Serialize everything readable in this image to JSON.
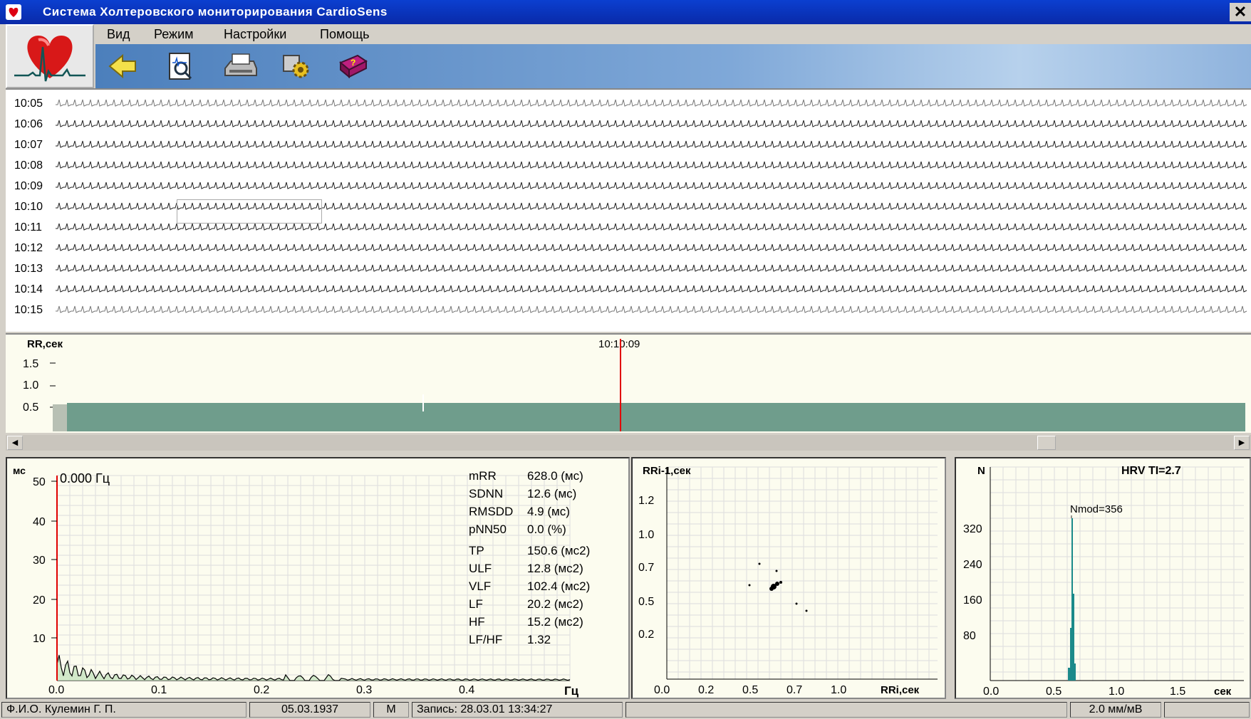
{
  "window": {
    "title": "Система   Холтеровского   мониторирования   CardioSens",
    "close": "✕"
  },
  "menu": {
    "items": [
      "Вид",
      "Режим",
      "Настройки",
      "Помощь"
    ]
  },
  "toolbar": {
    "buttons": [
      "back-arrow-icon",
      "magnifier-document-icon",
      "printer-icon",
      "settings-gear-icon",
      "help-book-icon"
    ]
  },
  "ecg": {
    "times": [
      "10:05",
      "10:06",
      "10:07",
      "10:08",
      "10:09",
      "10:10",
      "10:11",
      "10:12",
      "10:13",
      "10:14",
      "10:15"
    ]
  },
  "rr_trend": {
    "axis_label": "RR,сек",
    "cursor_time": "10:10:09",
    "ticks": [
      "1.5",
      "1.0",
      "0.5"
    ],
    "cursor_fraction": 0.47
  },
  "spectrum": {
    "unit_label": "мс",
    "cursor_label": "0.000 Гц",
    "y_ticks": [
      "50",
      "40",
      "30",
      "20",
      "10"
    ],
    "x_ticks": [
      "0.0",
      "0.1",
      "0.2",
      "0.3",
      "0.4"
    ],
    "x_unit": "Гц",
    "stats": [
      {
        "name": "mRR",
        "value": "628.0 (мс)"
      },
      {
        "name": "SDNN",
        "value": "12.6 (мс)"
      },
      {
        "name": "RMSDD",
        "value": "4.9 (мс)"
      },
      {
        "name": "pNN50",
        "value": "0.0 (%)"
      },
      {
        "name": "TP",
        "value": "150.6 (мс2)"
      },
      {
        "name": "ULF",
        "value": "12.8 (мс2)"
      },
      {
        "name": "VLF",
        "value": "102.4 (мс2)"
      },
      {
        "name": "LF",
        "value": "20.2 (мс2)"
      },
      {
        "name": "HF",
        "value": "15.2 (мс2)"
      },
      {
        "name": "LF/HF",
        "value": "1.32"
      }
    ]
  },
  "scatter": {
    "y_label": "RRi-1,сек",
    "x_label": "RRi,сек",
    "y_ticks": [
      "1.2",
      "1.0",
      "0.7",
      "0.5",
      "0.2"
    ],
    "x_ticks": [
      "0.0",
      "0.2",
      "0.5",
      "0.7",
      "1.0"
    ]
  },
  "histogram": {
    "y_label": "N",
    "title": "HRV TI=2.7",
    "mode_label": "Nmod=356",
    "y_ticks": [
      "320",
      "240",
      "160",
      "80"
    ],
    "x_ticks": [
      "0.0",
      "0.5",
      "1.0",
      "1.5"
    ],
    "x_unit": "сек"
  },
  "status": {
    "name": "Ф.И.О.  Кулемин   Г.  П.",
    "birth": "05.03.1937",
    "sex": "М",
    "record": "Запись: 28.03.01 13:34:27",
    "scale": "2.0 мм/мВ"
  },
  "colors": {
    "accent": "#0a2aa8",
    "trend": "#6f9d8c",
    "cursor": "#e00000",
    "hist": "#1b8a8a"
  }
}
